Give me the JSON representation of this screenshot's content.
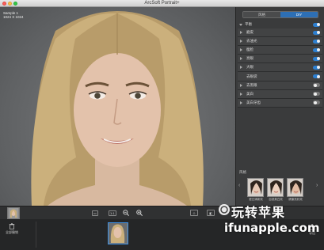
{
  "app": {
    "title": "ArcSoft Portrait+"
  },
  "image_info": {
    "name": "Sample 1",
    "size": "1024 X 1024"
  },
  "panel": {
    "tabs": [
      {
        "label": "风格",
        "active": false
      },
      {
        "label": "DIY",
        "active": true
      }
    ],
    "section": {
      "label": "平衡",
      "enabled": true
    },
    "items": [
      {
        "label": "磨皮",
        "enabled": true
      },
      {
        "label": "去油光",
        "enabled": true
      },
      {
        "label": "瘦脸",
        "enabled": true
      },
      {
        "label": "亮眼",
        "enabled": true
      },
      {
        "label": "大眼",
        "enabled": true
      },
      {
        "label": "去眼袋",
        "enabled": true
      },
      {
        "label": "去黑眼",
        "enabled": false
      },
      {
        "label": "美白",
        "enabled": false
      },
      {
        "label": "美白牙齿",
        "enabled": false
      }
    ],
    "presets": {
      "label": "风格",
      "items": [
        {
          "label": "更日清新效"
        },
        {
          "label": "自然美白效"
        },
        {
          "label": "健康亮彩效"
        }
      ]
    }
  },
  "toolbar": {
    "fit_label": "1:1",
    "zoom_out_icon": "zoom-out-icon",
    "zoom_in_icon": "zoom-in-icon"
  },
  "filmstrip": {
    "left_label": "全部撤销",
    "right_label": "导出"
  },
  "watermark": {
    "cn": "玩转苹果",
    "en": "ifunapple.com"
  },
  "colors": {
    "accent": "#2d7fd0",
    "panel_bg": "#3a3b3c"
  }
}
